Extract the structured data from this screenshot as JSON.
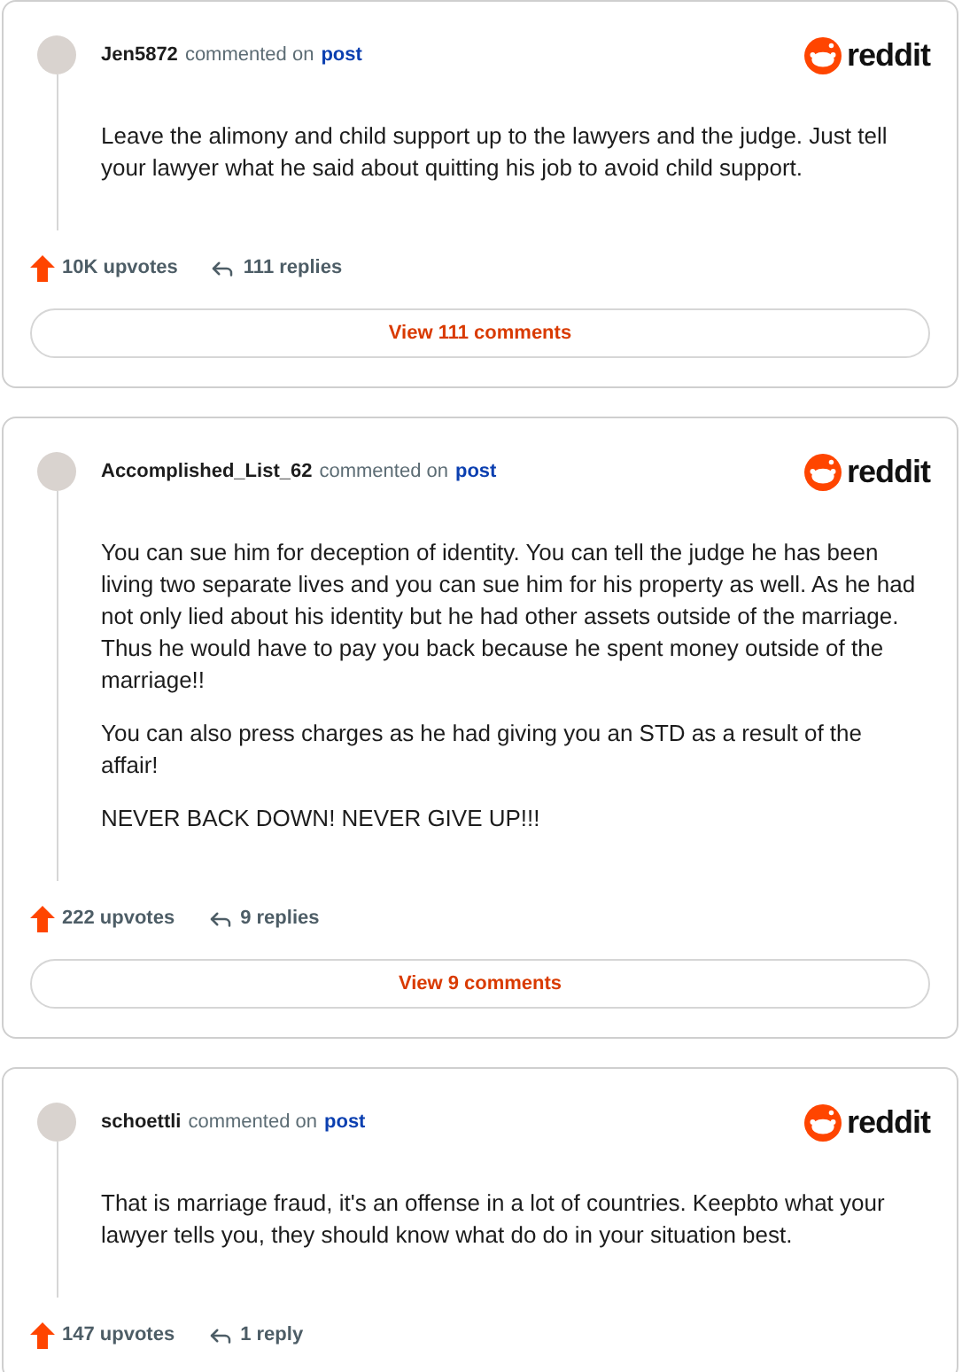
{
  "comments": [
    {
      "author": "Jen5872",
      "action": "commented on",
      "target": "post",
      "brand": "reddit",
      "paragraphs": [
        "Leave the alimony and child support up to the lawyers and the judge. Just tell your lawyer what he said about quitting his job to avoid child support."
      ],
      "upvotes": "10K upvotes",
      "replies": "111 replies",
      "view_button": "View 111 comments"
    },
    {
      "author": "Accomplished_List_62",
      "action": "commented on",
      "target": "post",
      "brand": "reddit",
      "paragraphs": [
        "You can sue him for deception of identity. You can tell the judge he has been living two separate lives and you can sue him for his property as well. As he had not only lied about his identity but he had other assets outside of the marriage. Thus he would have to pay you back because he spent money outside of the marriage!!",
        "You can also press charges as he had giving you an STD as a result of the affair!",
        "NEVER BACK DOWN! NEVER GIVE UP!!!"
      ],
      "upvotes": "222 upvotes",
      "replies": "9 replies",
      "view_button": "View 9 comments"
    },
    {
      "author": "schoettli",
      "action": "commented on",
      "target": "post",
      "brand": "reddit",
      "paragraphs": [
        "That is marriage fraud, it's an offense in a lot of countries. Keepbto what your lawyer tells you, they should know what do do in your situation best."
      ],
      "upvotes": "147 upvotes",
      "replies": "1 reply"
    }
  ]
}
